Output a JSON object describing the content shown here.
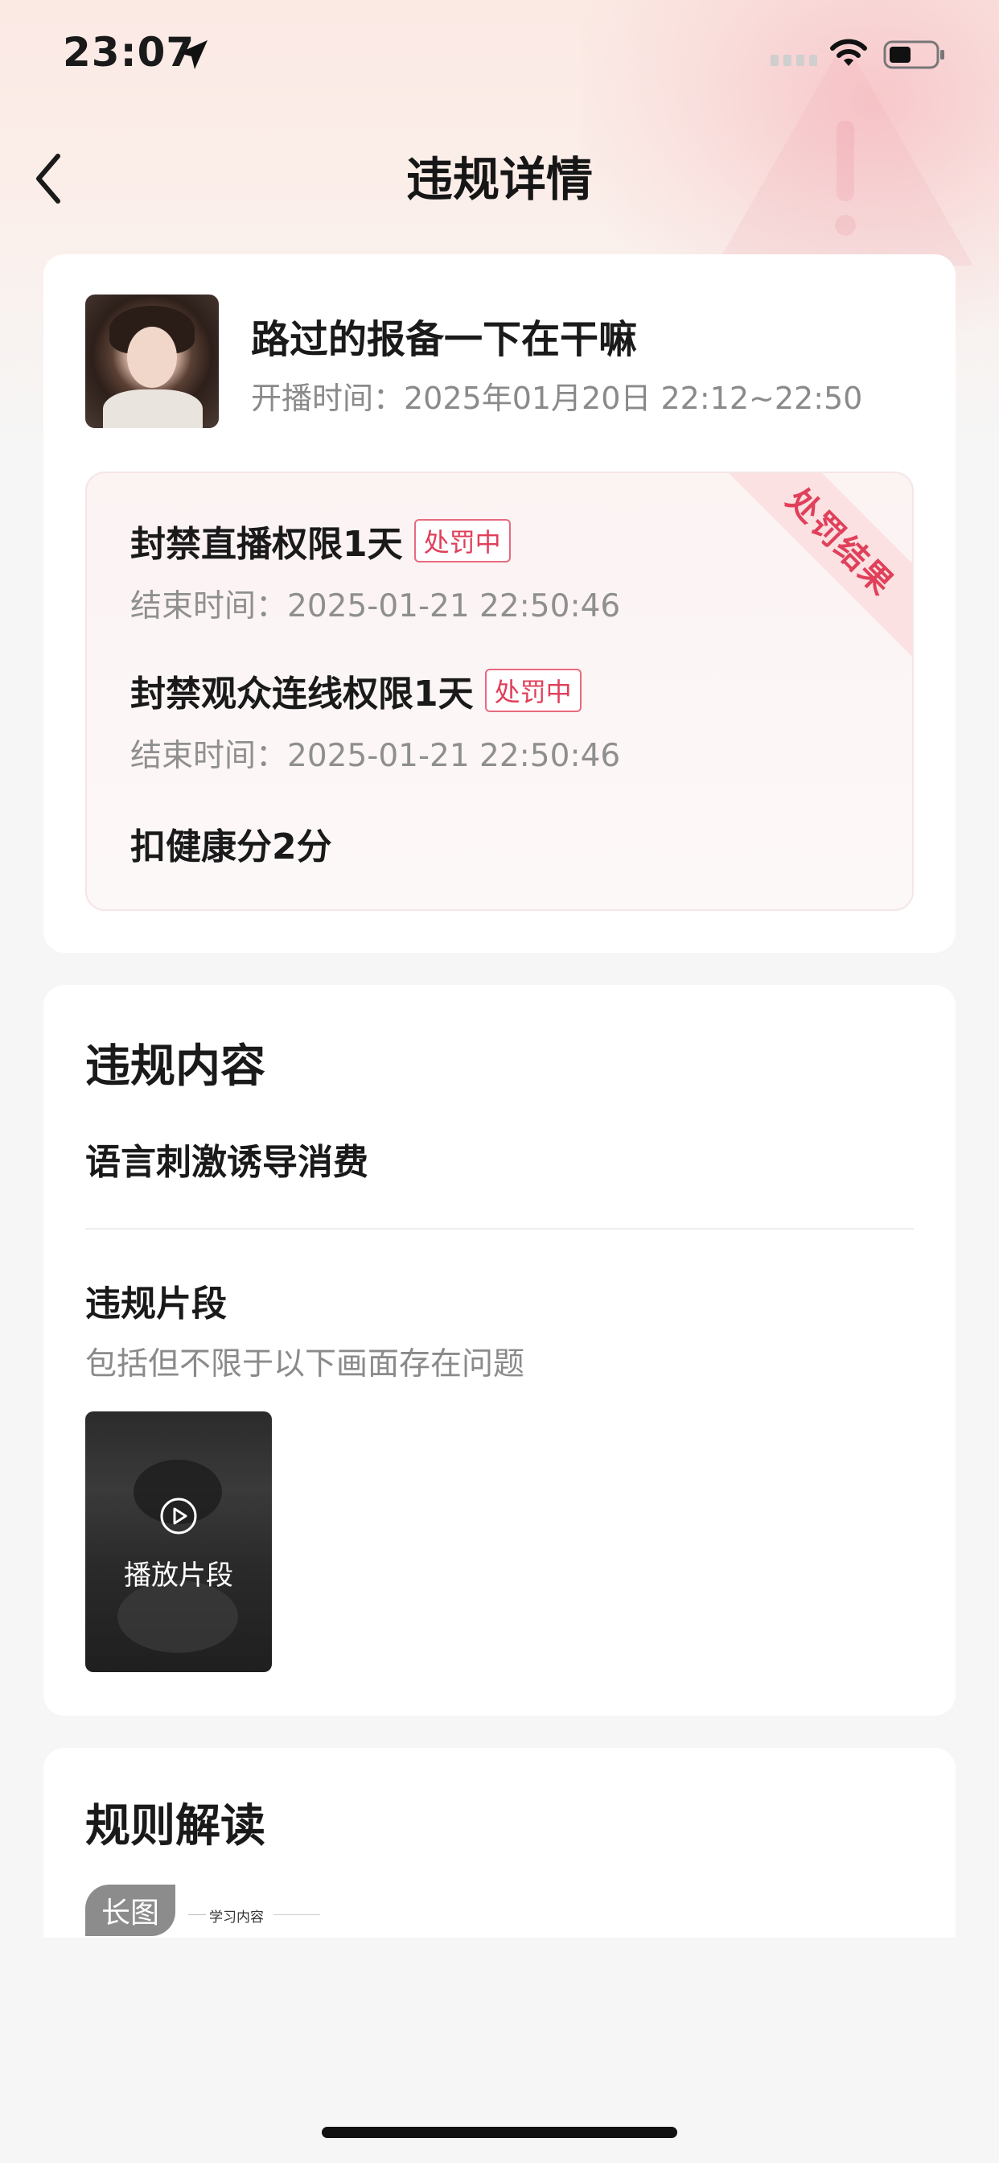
{
  "status_bar": {
    "time": "23:07"
  },
  "nav": {
    "title": "违规详情"
  },
  "streamer": {
    "name": "路过的报备一下在干嘛",
    "stream_time": "开播时间：2025年01月20日 22:12~22:50"
  },
  "penalty": {
    "ribbon": "处罚结果",
    "items": [
      {
        "title": "封禁直播权限1天",
        "badge": "处罚中",
        "end_time": "结束时间：2025-01-21 22:50:46"
      },
      {
        "title": "封禁观众连线权限1天",
        "badge": "处罚中",
        "end_time": "结束时间：2025-01-21 22:50:46"
      }
    ],
    "health_score": "扣健康分2分"
  },
  "violation": {
    "section_title": "违规内容",
    "content": "语言刺激诱导消费",
    "clip_title": "违规片段",
    "clip_desc": "包括但不限于以下画面存在问题",
    "clip_button": "播放片段"
  },
  "rules": {
    "section_title": "规则解读",
    "tag": "长图",
    "study_label": "学习内容"
  },
  "colors": {
    "accent_red": "#e03f5a",
    "ribbon_bg": "#fbe1e1",
    "page_bg": "#f6f6f6"
  }
}
